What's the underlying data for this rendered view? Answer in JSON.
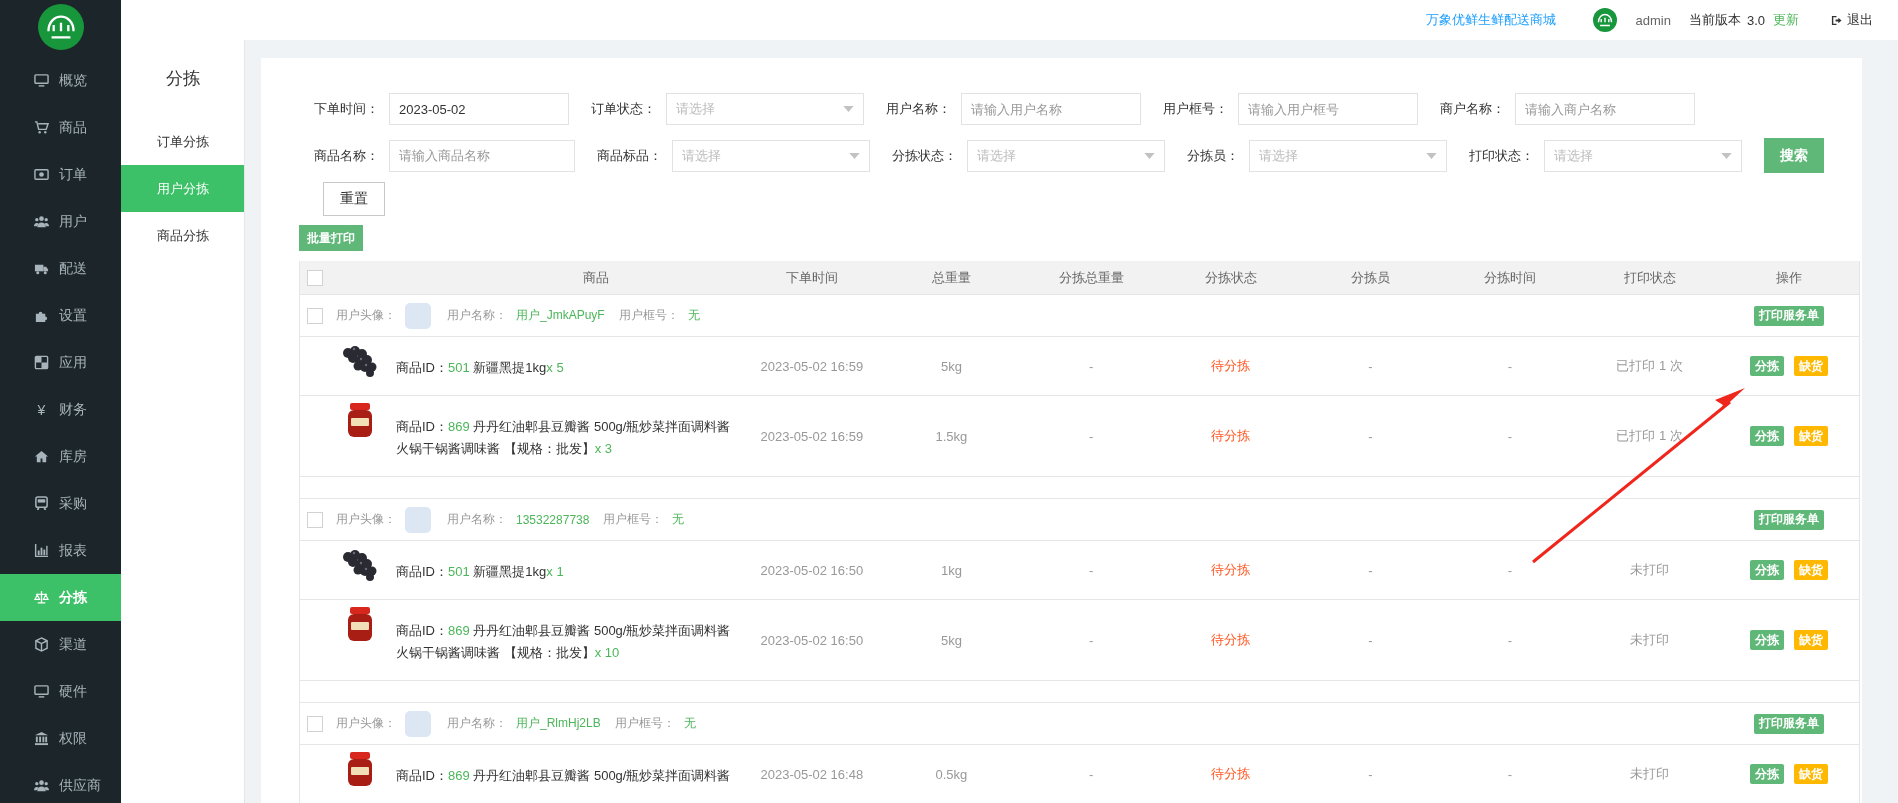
{
  "sidebar": {
    "items": [
      {
        "label": "概览",
        "selected": false
      },
      {
        "label": "商品",
        "selected": false
      },
      {
        "label": "订单",
        "selected": false
      },
      {
        "label": "用户",
        "selected": false
      },
      {
        "label": "配送",
        "selected": false
      },
      {
        "label": "设置",
        "selected": false
      },
      {
        "label": "应用",
        "selected": false
      },
      {
        "label": "财务",
        "selected": false,
        "icon_char": "¥"
      },
      {
        "label": "库房",
        "selected": false
      },
      {
        "label": "采购",
        "selected": false
      },
      {
        "label": "报表",
        "selected": false
      },
      {
        "label": "分拣",
        "selected": true
      },
      {
        "label": "渠道",
        "selected": false
      },
      {
        "label": "硬件",
        "selected": false
      },
      {
        "label": "权限",
        "selected": false
      },
      {
        "label": "供应商",
        "selected": false
      }
    ]
  },
  "header": {
    "shop_link": "万象优鲜生鲜配送商城",
    "user": "admin",
    "version_label": "当前版本",
    "version": "3.0",
    "update_link": "更新",
    "logout": "退出"
  },
  "submenu": {
    "title": "分拣",
    "items": [
      {
        "label": "订单分拣",
        "selected": false
      },
      {
        "label": "用户分拣",
        "selected": true
      },
      {
        "label": "商品分拣",
        "selected": false
      }
    ]
  },
  "filters": [
    {
      "label": "下单时间：",
      "kind": "input",
      "value": "2023-05-02"
    },
    {
      "label": "订单状态：",
      "kind": "select",
      "placeholder": "请选择"
    },
    {
      "label": "用户名称：",
      "kind": "input",
      "placeholder": "请输入用户名称"
    },
    {
      "label": "用户框号：",
      "kind": "input",
      "placeholder": "请输入用户框号"
    },
    {
      "label": "商户名称：",
      "kind": "input",
      "placeholder": "请输入商户名称"
    },
    {
      "label": "商品名称：",
      "kind": "input",
      "placeholder": "请输入商品名称"
    },
    {
      "label": "商品标品：",
      "kind": "select",
      "placeholder": "请选择"
    },
    {
      "label": "分拣状态：",
      "kind": "select",
      "placeholder": "请选择"
    },
    {
      "label": "分拣员：",
      "kind": "select",
      "placeholder": "请选择"
    },
    {
      "label": "打印状态：",
      "kind": "select",
      "placeholder": "请选择"
    }
  ],
  "search_button": "搜索",
  "reset_button": "重置",
  "batch_print_button": "批量打印",
  "table": {
    "select_all_checked": false,
    "columns": [
      "商品",
      "下单时间",
      "总重量",
      "分拣总重量",
      "分拣状态",
      "分拣员",
      "分拣时间",
      "打印状态",
      "操作"
    ],
    "groups": [
      {
        "checked": false,
        "avatar_label": "用户头像：",
        "name_label": "用户名称：",
        "name": "用户_JmkAPuyF",
        "box_label": "用户框号：",
        "box": "无",
        "print_button": "打印服务单",
        "items": [
          {
            "kind": "grapes",
            "id_label": "商品ID：",
            "id": "501",
            "name": "新疆黑提1kg",
            "qty": "x 5",
            "time": "2023-05-02 16:59",
            "weight": "5kg",
            "sorted_weight": "-",
            "status": "待分拣",
            "sorter": "-",
            "sort_time": "-",
            "print_status": "已打印 1 次",
            "actions": [
              {
                "label": "分拣",
                "kind": "sort"
              },
              {
                "label": "缺货",
                "kind": "shortage"
              }
            ]
          },
          {
            "kind": "jar",
            "id_label": "商品ID：",
            "id": "869",
            "name": "丹丹红油郫县豆瓣酱 500g/瓶炒菜拌面调料酱火锅干锅酱调味酱 【规格：批发】",
            "qty": "x 3",
            "time": "2023-05-02 16:59",
            "weight": "1.5kg",
            "sorted_weight": "-",
            "status": "待分拣",
            "sorter": "-",
            "sort_time": "-",
            "print_status": "已打印 1 次",
            "actions": [
              {
                "label": "分拣",
                "kind": "sort"
              },
              {
                "label": "缺货",
                "kind": "shortage"
              }
            ]
          }
        ]
      },
      {
        "checked": false,
        "avatar_label": "用户头像：",
        "name_label": "用户名称：",
        "name": "13532287738",
        "box_label": "用户框号：",
        "box": "无",
        "print_button": "打印服务单",
        "items": [
          {
            "kind": "grapes",
            "id_label": "商品ID：",
            "id": "501",
            "name": "新疆黑提1kg",
            "qty": "x 1",
            "time": "2023-05-02 16:50",
            "weight": "1kg",
            "sorted_weight": "-",
            "status": "待分拣",
            "sorter": "-",
            "sort_time": "-",
            "print_status": "未打印",
            "actions": [
              {
                "label": "分拣",
                "kind": "sort"
              },
              {
                "label": "缺货",
                "kind": "shortage"
              }
            ]
          },
          {
            "kind": "jar",
            "id_label": "商品ID：",
            "id": "869",
            "name": "丹丹红油郫县豆瓣酱 500g/瓶炒菜拌面调料酱火锅干锅酱调味酱 【规格：批发】",
            "qty": "x 10",
            "time": "2023-05-02 16:50",
            "weight": "5kg",
            "sorted_weight": "-",
            "status": "待分拣",
            "sorter": "-",
            "sort_time": "-",
            "print_status": "未打印",
            "actions": [
              {
                "label": "分拣",
                "kind": "sort"
              },
              {
                "label": "缺货",
                "kind": "shortage"
              }
            ]
          }
        ]
      },
      {
        "checked": false,
        "avatar_label": "用户头像：",
        "name_label": "用户名称：",
        "name": "用户_RlmHj2LB",
        "box_label": "用户框号：",
        "box": "无",
        "print_button": "打印服务单",
        "items": [
          {
            "kind": "jar",
            "id_label": "商品ID：",
            "id": "869",
            "name": "丹丹红油郫县豆瓣酱 500g/瓶炒菜拌面调料酱",
            "time": "2023-05-02 16:48",
            "weight": "0.5kg",
            "sorted_weight": "-",
            "status": "待分拣",
            "sorter": "-",
            "sort_time": "-",
            "print_status": "未打印",
            "actions": [
              {
                "label": "分拣",
                "kind": "sort"
              },
              {
                "label": "缺货",
                "kind": "shortage"
              }
            ]
          }
        ]
      }
    ]
  }
}
